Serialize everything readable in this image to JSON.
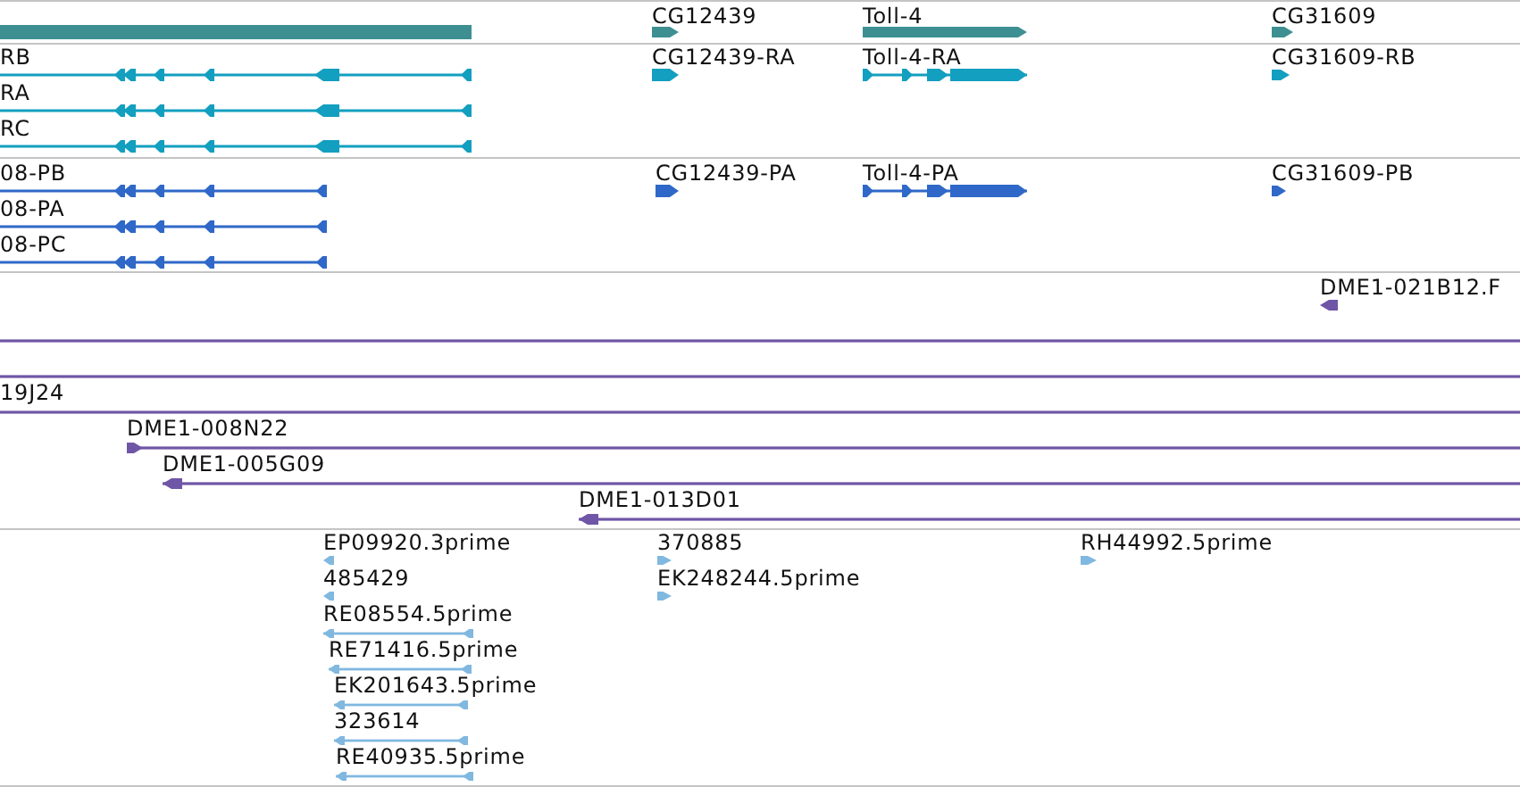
{
  "tracks": [
    {
      "kind": "genes",
      "color": "#3d8f92",
      "features": [
        {
          "kind": "block"
        },
        {
          "kind": "block",
          "label": "CG12439",
          "forward": true
        },
        {
          "kind": "block",
          "label": "Toll-4",
          "forward": true
        },
        {
          "kind": "block",
          "label": "CG31609",
          "forward": true
        }
      ]
    },
    {
      "kind": "transcripts",
      "color": "#139fbf",
      "features": [
        {
          "kind": "spliced",
          "label": "RB",
          "forward": false
        },
        {
          "kind": "spliced",
          "label": "RA",
          "forward": false
        },
        {
          "kind": "spliced",
          "label": "RC",
          "forward": false
        },
        {
          "kind": "block",
          "label": "CG12439-RA",
          "forward": true
        },
        {
          "kind": "spliced",
          "label": "Toll-4-RA",
          "forward": true
        },
        {
          "kind": "block",
          "label": "CG31609-RB",
          "forward": true
        }
      ]
    },
    {
      "kind": "proteins",
      "color": "#2f68c8",
      "features": [
        {
          "kind": "spliced",
          "label": "08-PB",
          "forward": false
        },
        {
          "kind": "spliced",
          "label": "08-PA",
          "forward": false
        },
        {
          "kind": "spliced",
          "label": "08-PC",
          "forward": false
        },
        {
          "kind": "block",
          "label": "CG12439-PA",
          "forward": true
        },
        {
          "kind": "spliced",
          "label": "Toll-4-PA",
          "forward": true
        },
        {
          "kind": "block",
          "label": "CG31609-PB",
          "forward": true
        }
      ]
    },
    {
      "kind": "clones",
      "color": "#6f56a6",
      "features": [
        {
          "kind": "block",
          "label": "DME1-021B12.F",
          "forward": false
        },
        {
          "kind": "spliced"
        },
        {
          "kind": "spliced"
        },
        {
          "kind": "spliced",
          "label": "19J24"
        },
        {
          "kind": "spliced",
          "label": "DME1-008N22",
          "forward": true
        },
        {
          "kind": "spliced",
          "label": "DME1-005G09",
          "forward": false
        },
        {
          "kind": "spliced",
          "label": "DME1-013D01",
          "forward": false
        }
      ]
    },
    {
      "kind": "ests",
      "color": "#80b8e0",
      "features": [
        {
          "kind": "block",
          "label": "EP09920.3prime",
          "forward": false
        },
        {
          "kind": "block",
          "label": "485429",
          "forward": false
        },
        {
          "kind": "spliced",
          "label": "RE08554.5prime",
          "forward": false
        },
        {
          "kind": "spliced",
          "label": "RE71416.5prime",
          "forward": false
        },
        {
          "kind": "spliced",
          "label": "EK201643.5prime",
          "forward": false
        },
        {
          "kind": "spliced",
          "label": "323614",
          "forward": false
        },
        {
          "kind": "spliced",
          "label": "RE40935.5prime",
          "forward": false
        },
        {
          "kind": "block",
          "label": "370885",
          "forward": true
        },
        {
          "kind": "block",
          "label": "EK248244.5prime",
          "forward": true
        },
        {
          "kind": "block",
          "label": "RH44992.5prime",
          "forward": true
        }
      ]
    }
  ]
}
